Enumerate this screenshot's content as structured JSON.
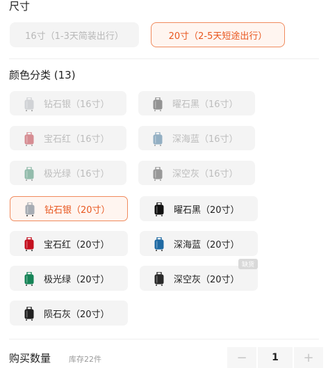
{
  "size": {
    "title": "尺寸",
    "options": [
      {
        "label": "16寸（1-3天简装出行）",
        "state": "disabled"
      },
      {
        "label": "20寸（2-5天短途出行）",
        "state": "selected"
      }
    ]
  },
  "colors": {
    "title": "颜色分类 (13)",
    "options": [
      {
        "label": "钻石银（16寸）",
        "state": "disabled",
        "thumb_color": "#a7acb3"
      },
      {
        "label": "曜石黑（16寸）",
        "state": "disabled",
        "thumb_color": "#1f1f1f"
      },
      {
        "label": "宝石红（16寸）",
        "state": "disabled",
        "thumb_color": "#b3111e"
      },
      {
        "label": "深海蓝（16寸）",
        "state": "disabled",
        "thumb_color": "#1f5c8a"
      },
      {
        "label": "极光绿（16寸）",
        "state": "disabled",
        "thumb_color": "#1f7a56"
      },
      {
        "label": "深空灰（16寸）",
        "state": "disabled",
        "thumb_color": "#2a2a2a"
      },
      {
        "label": "钻石银（20寸）",
        "state": "selected",
        "thumb_color": "#a7acb3"
      },
      {
        "label": "曜石黑（20寸）",
        "state": "enabled",
        "thumb_color": "#111111"
      },
      {
        "label": "宝石红（20寸）",
        "state": "enabled",
        "thumb_color": "#c4101f"
      },
      {
        "label": "深海蓝（20寸）",
        "state": "enabled",
        "thumb_color": "#1f6aa3"
      },
      {
        "label": "极光绿（20寸）",
        "state": "enabled",
        "thumb_color": "#168457"
      },
      {
        "label": "深空灰（20寸）",
        "state": "enabled",
        "thumb_color": "#2a2a2a"
      },
      {
        "label": "陨石灰（20寸）",
        "state": "enabled",
        "thumb_color": "#222222"
      }
    ],
    "badge": "缺货"
  },
  "quantity": {
    "label": "购买数量",
    "stock": "库存22件",
    "value": "1",
    "minus": "−",
    "plus": "+"
  },
  "theme": {
    "accent": "#e8571f",
    "accent_border": "#f08a5d",
    "accent_bg": "#fff5f0",
    "chip_bg": "#f4f4f4",
    "disabled_text": "#bdbdbd"
  }
}
